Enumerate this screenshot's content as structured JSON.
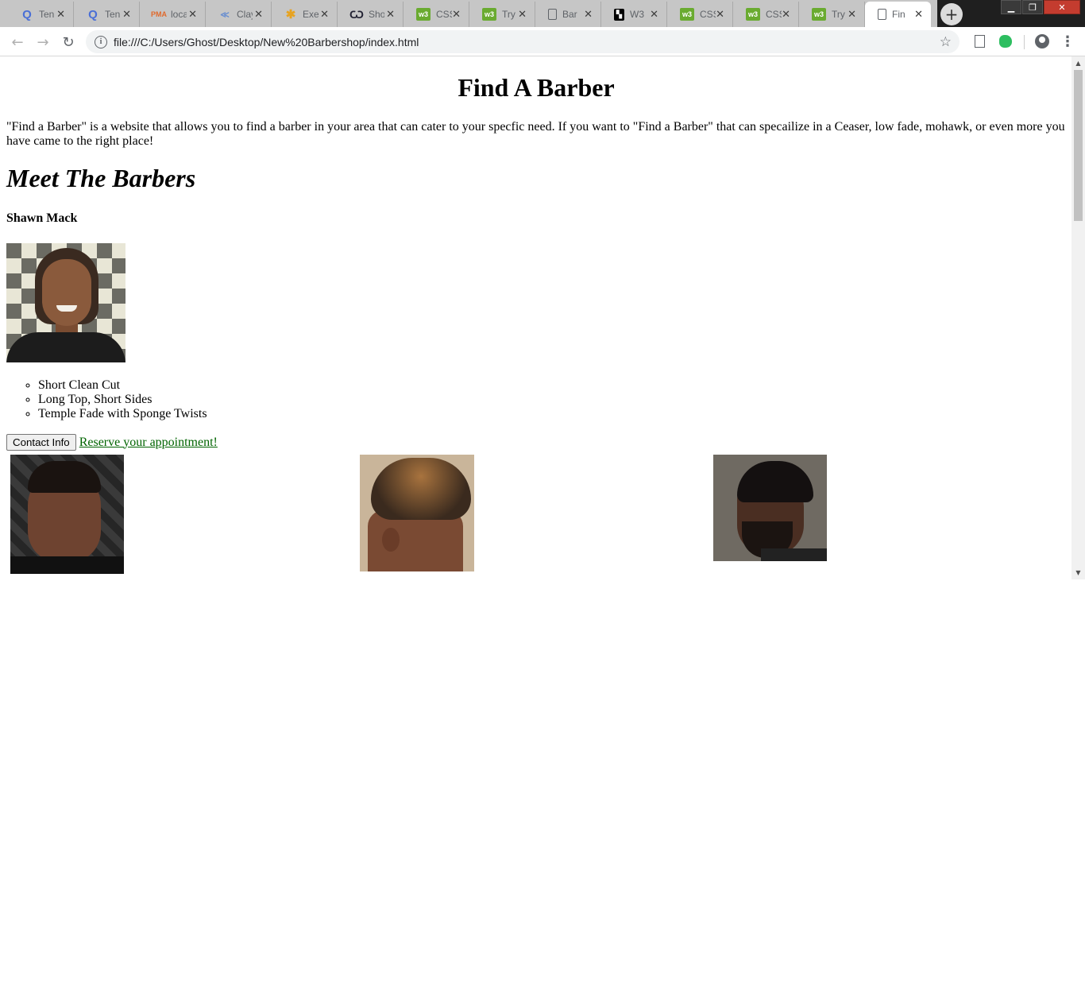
{
  "browser": {
    "tabs": [
      {
        "label": "Ten",
        "icon": "q-icon",
        "active": false
      },
      {
        "label": "Ten",
        "icon": "q-icon",
        "active": false
      },
      {
        "label": "loca",
        "icon": "phpmyadmin-icon",
        "active": false
      },
      {
        "label": "Clay",
        "icon": "clay-icon",
        "active": false
      },
      {
        "label": "Exe",
        "icon": "exercise-icon",
        "active": false
      },
      {
        "label": "Sho",
        "icon": "shopify-icon",
        "active": false
      },
      {
        "label": "CSS",
        "icon": "w3schools-icon",
        "active": false
      },
      {
        "label": "Try",
        "icon": "w3schools-icon",
        "active": false
      },
      {
        "label": "Bar",
        "icon": "document-icon",
        "active": false
      },
      {
        "label": "W3",
        "icon": "w3s-dark-icon",
        "active": false
      },
      {
        "label": "CSS",
        "icon": "w3schools-icon",
        "active": false
      },
      {
        "label": "CSS",
        "icon": "w3schools-icon",
        "active": false
      },
      {
        "label": "Try",
        "icon": "w3schools-icon",
        "active": false
      },
      {
        "label": "Fin",
        "icon": "document-icon",
        "active": true
      }
    ],
    "url": "file:///C:/Users/Ghost/Desktop/New%20Barbershop/index.html"
  },
  "page": {
    "title": "Find A Barber",
    "intro": "\"Find a Barber\" is a website that allows you to find a barber in your area that can cater to your specfic need. If you want to \"Find a Barber\" that can specailize in a Ceaser, low fade, mohawk, or even more you have came to the right place!",
    "section_heading": "Meet The Barbers",
    "barber": {
      "name": "Shawn Mack",
      "cuts": [
        "Short Clean Cut",
        "Long Top, Short Sides",
        "Temple Fade with Sponge Twists"
      ],
      "contact_button": "Contact Info",
      "reserve_link": "Reserve your appointment!"
    }
  },
  "colors": {
    "link": "#006400",
    "tabstrip": "#c6c6c6",
    "close_button": "#c43c2f"
  }
}
